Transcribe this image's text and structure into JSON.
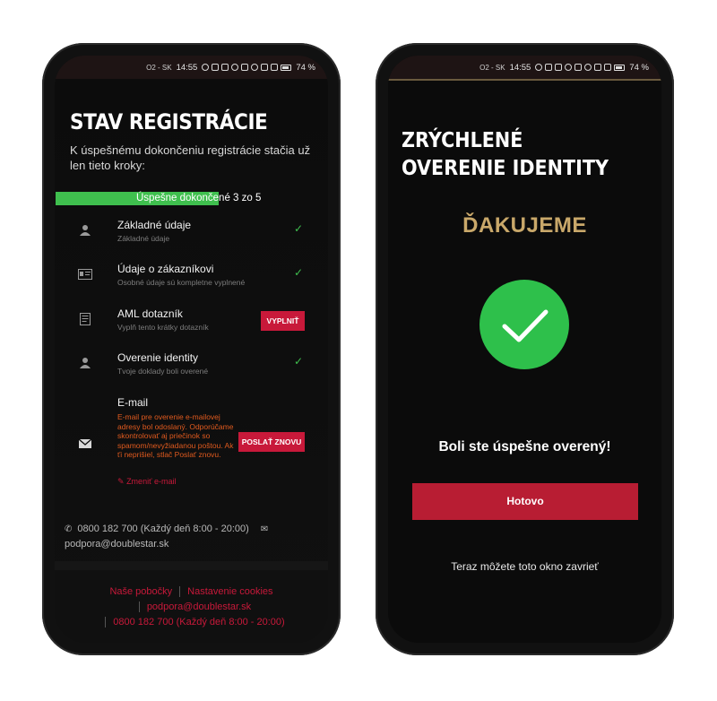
{
  "left": {
    "status": {
      "carrier": "O2 - SK",
      "time": "14:55",
      "battery": "74 %"
    },
    "title": "STAV REGISTRÁCIE",
    "subtitle": "K úspešnému dokončeniu registrácie stačia už len tieto kroky:",
    "progress": {
      "label": "Úspešne dokončené 3 zo 5",
      "completed": 3,
      "total": 5,
      "color": "#3fbf4e"
    },
    "steps": [
      {
        "title": "Základné údaje",
        "desc": "Základné údaje",
        "icon": "user-icon",
        "done": true
      },
      {
        "title": "Údaje o zákazníkovi",
        "desc": "Osobné údaje sú kompletne vyplnené",
        "icon": "id-card-icon",
        "done": true
      },
      {
        "title": "AML dotazník",
        "desc": "Vyplň tento krátky dotazník",
        "icon": "form-icon",
        "action": "VYPLNIŤ"
      },
      {
        "title": "Overenie identity",
        "desc": "Tvoje doklady boli overené",
        "icon": "user-icon",
        "done": true
      },
      {
        "title": "E-mail",
        "desc": "E-mail pre overenie e-mailovej adresy bol odoslaný. Odporúčame skontrolovať aj priečinok so spamom/nevyžiadanou poštou. Ak ťi neprišiel, stlač Poslať znovu.",
        "icon": "envelope-icon",
        "action": "POSLAŤ ZNOVU",
        "link": "Zmeniť e-mail"
      }
    ],
    "contact": {
      "phone": "0800 182 700 (Každý deň 8:00 - 20:00)",
      "email": "podpora@doublestar.sk"
    },
    "footer": {
      "branches": "Naše pobočky",
      "cookies": "Nastavenie cookies",
      "email": "podpora@doublestar.sk",
      "phone": "0800 182 700 (Každý deň 8:00 - 20:00)"
    }
  },
  "right": {
    "status": {
      "carrier": "O2 - SK",
      "time": "14:55",
      "battery": "74 %"
    },
    "title": "ZRÝCHLENÉ OVERENIE IDENTITY",
    "thanks": "ĎAKUJEME",
    "message": "Boli ste úspešne overený!",
    "button": "Hotovo",
    "close_note": "Teraz môžete toto okno zavrieť"
  }
}
